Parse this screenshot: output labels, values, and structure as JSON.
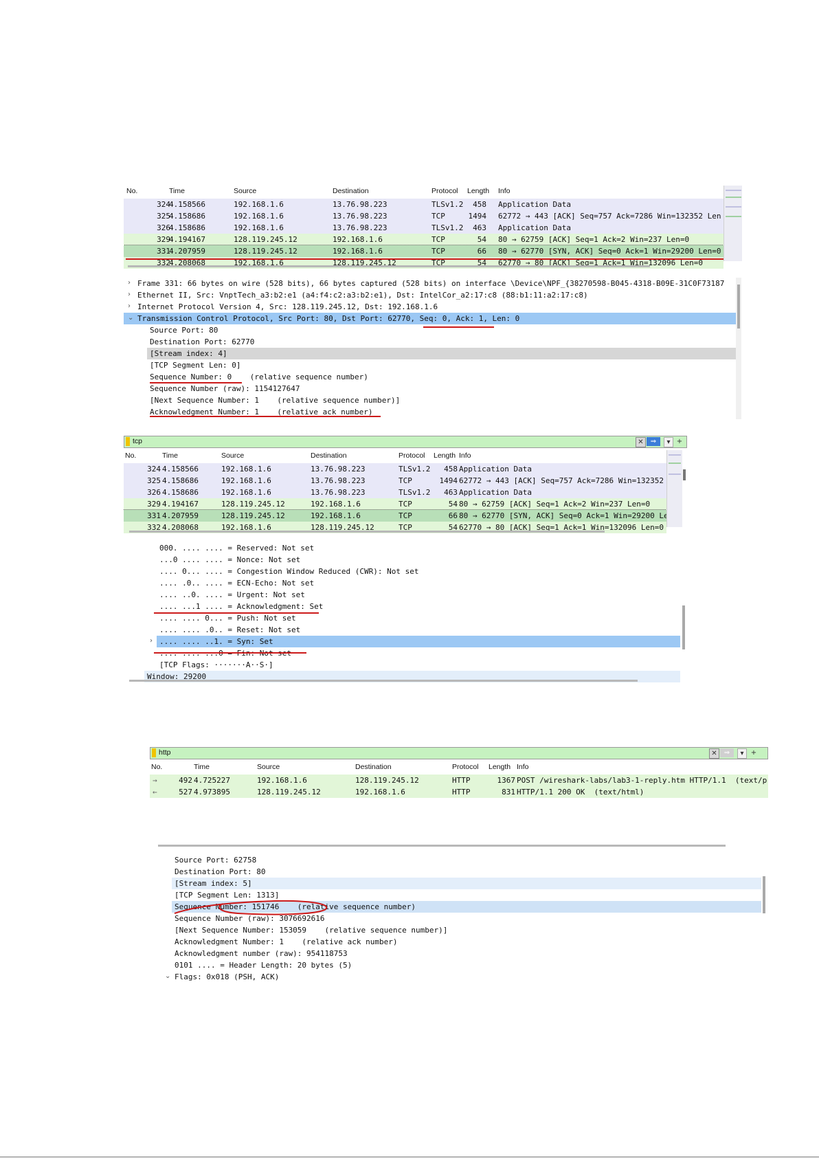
{
  "columns": [
    "No.",
    "Time",
    "Source",
    "Destination",
    "Protocol",
    "Length",
    "Info"
  ],
  "panel1": {
    "packets": [
      {
        "no": "324",
        "time": "4.158566",
        "src": "192.168.1.6",
        "dst": "13.76.98.223",
        "proto": "TLSv1.2",
        "len": "458",
        "info": "Application Data",
        "color": "purple"
      },
      {
        "no": "325",
        "time": "4.158686",
        "src": "192.168.1.6",
        "dst": "13.76.98.223",
        "proto": "TCP",
        "len": "1494",
        "info": "62772 → 443 [ACK] Seq=757 Ack=7286 Win=132352 Len",
        "color": "purple"
      },
      {
        "no": "326",
        "time": "4.158686",
        "src": "192.168.1.6",
        "dst": "13.76.98.223",
        "proto": "TLSv1.2",
        "len": "463",
        "info": "Application Data",
        "color": "purple"
      },
      {
        "no": "329",
        "time": "4.194167",
        "src": "128.119.245.12",
        "dst": "192.168.1.6",
        "proto": "TCP",
        "len": "54",
        "info": "80 → 62759 [ACK] Seq=1 Ack=2 Win=237 Len=0",
        "color": "green"
      },
      {
        "no": "331",
        "time": "4.207959",
        "src": "128.119.245.12",
        "dst": "192.168.1.6",
        "proto": "TCP",
        "len": "66",
        "info": "80 → 62770 [SYN, ACK] Seq=0 Ack=1 Win=29200 Len=0",
        "color": "sel"
      },
      {
        "no": "332",
        "time": "4.208068",
        "src": "192.168.1.6",
        "dst": "128.119.245.12",
        "proto": "TCP",
        "len": "54",
        "info": "62770 → 80 [ACK] Seq=1 Ack=1 Win=132096 Len=0",
        "color": "green"
      }
    ],
    "details": [
      {
        "text": "Frame 331: 66 bytes on wire (528 bits), 66 bytes captured (528 bits) on interface \\Device\\NPF_{38270598-B045-4318-B09E-31C0F73187",
        "arrow": "›",
        "indent": 0
      },
      {
        "text": "Ethernet II, Src: VnptTech_a3:b2:e1 (a4:f4:c2:a3:b2:e1), Dst: IntelCor_a2:17:c8 (88:b1:11:a2:17:c8)",
        "arrow": "›",
        "indent": 0
      },
      {
        "text": "Internet Protocol Version 4, Src: 128.119.245.12, Dst: 192.168.1.6",
        "arrow": "›",
        "indent": 0
      },
      {
        "text": "Transmission Control Protocol, Src Port: 80, Dst Port: 62770, Seq: 0, Ack: 1, Len: 0",
        "arrow": "⌄",
        "indent": 0,
        "hl": "blue"
      },
      {
        "text": "Source Port: 80",
        "arrow": "",
        "indent": 1
      },
      {
        "text": "Destination Port: 62770",
        "arrow": "",
        "indent": 1
      },
      {
        "text": "[Stream index: 4]",
        "arrow": "",
        "indent": 1,
        "hl": "gray"
      },
      {
        "text": "[TCP Segment Len: 0]",
        "arrow": "",
        "indent": 1
      },
      {
        "text": "Sequence Number: 0    (relative sequence number)",
        "arrow": "",
        "indent": 1
      },
      {
        "text": "Sequence Number (raw): 1154127647",
        "arrow": "",
        "indent": 1
      },
      {
        "text": "[Next Sequence Number: 1    (relative sequence number)]",
        "arrow": "",
        "indent": 1
      },
      {
        "text": "Acknowledgment Number: 1    (relative ack number)",
        "arrow": "",
        "indent": 1
      }
    ]
  },
  "panel2": {
    "filter": "tcp",
    "packets": [
      {
        "no": "324",
        "time": "4.158566",
        "src": "192.168.1.6",
        "dst": "13.76.98.223",
        "proto": "TLSv1.2",
        "len": "458",
        "info": "Application Data",
        "color": "purple"
      },
      {
        "no": "325",
        "time": "4.158686",
        "src": "192.168.1.6",
        "dst": "13.76.98.223",
        "proto": "TCP",
        "len": "1494",
        "info": "62772 → 443 [ACK] Seq=757 Ack=7286 Win=132352 Len",
        "color": "purple"
      },
      {
        "no": "326",
        "time": "4.158686",
        "src": "192.168.1.6",
        "dst": "13.76.98.223",
        "proto": "TLSv1.2",
        "len": "463",
        "info": "Application Data",
        "color": "purple"
      },
      {
        "no": "329",
        "time": "4.194167",
        "src": "128.119.245.12",
        "dst": "192.168.1.6",
        "proto": "TCP",
        "len": "54",
        "info": "80 → 62759 [ACK] Seq=1 Ack=2 Win=237 Len=0",
        "color": "green"
      },
      {
        "no": "331",
        "time": "4.207959",
        "src": "128.119.245.12",
        "dst": "192.168.1.6",
        "proto": "TCP",
        "len": "66",
        "info": "80 → 62770 [SYN, ACK] Seq=0 Ack=1 Win=29200 Len=0",
        "color": "sel"
      },
      {
        "no": "332",
        "time": "4.208068",
        "src": "192.168.1.6",
        "dst": "128.119.245.12",
        "proto": "TCP",
        "len": "54",
        "info": "62770 → 80 [ACK] Seq=1 Ack=1 Win=132096 Len=0",
        "color": "green"
      }
    ],
    "details": [
      {
        "text": "000. .... .... = Reserved: Not set",
        "arrow": "",
        "indent": 2
      },
      {
        "text": "...0 .... .... = Nonce: Not set",
        "arrow": "",
        "indent": 2
      },
      {
        "text": ".... 0... .... = Congestion Window Reduced (CWR): Not set",
        "arrow": "",
        "indent": 2
      },
      {
        "text": ".... .0.. .... = ECN-Echo: Not set",
        "arrow": "",
        "indent": 2
      },
      {
        "text": ".... ..0. .... = Urgent: Not set",
        "arrow": "",
        "indent": 2
      },
      {
        "text": ".... ...1 .... = Acknowledgment: Set",
        "arrow": "",
        "indent": 2
      },
      {
        "text": ".... .... 0... = Push: Not set",
        "arrow": "",
        "indent": 2
      },
      {
        "text": ".... .... .0.. = Reset: Not set",
        "arrow": "",
        "indent": 2
      },
      {
        "text": ".... .... ..1. = Syn: Set",
        "arrow": "›",
        "indent": 2,
        "hl": "blue"
      },
      {
        "text": ".... .... ...0 = Fin: Not set",
        "arrow": "",
        "indent": 2
      },
      {
        "text": "[TCP Flags: ·······A··S·]",
        "arrow": "",
        "indent": 2
      },
      {
        "text": "Window: 29200",
        "arrow": "",
        "indent": 1,
        "hl": "light"
      }
    ]
  },
  "panel3": {
    "filter": "http",
    "packets": [
      {
        "no": "492",
        "time": "4.725227",
        "src": "192.168.1.6",
        "dst": "128.119.245.12",
        "proto": "HTTP",
        "len": "1367",
        "info": "POST /wireshark-labs/lab3-1-reply.htm HTTP/1.1  (text/p",
        "color": "green",
        "mark": "→"
      },
      {
        "no": "527",
        "time": "4.973895",
        "src": "128.119.245.12",
        "dst": "192.168.1.6",
        "proto": "HTTP",
        "len": "831",
        "info": "HTTP/1.1 200 OK  (text/html)",
        "color": "green",
        "mark": "←"
      }
    ],
    "details": [
      {
        "text": "Source Port: 62758",
        "arrow": "",
        "indent": 1
      },
      {
        "text": "Destination Port: 80",
        "arrow": "",
        "indent": 1
      },
      {
        "text": "[Stream index: 5]",
        "arrow": "",
        "indent": 1,
        "hl": "light"
      },
      {
        "text": "[TCP Segment Len: 1313]",
        "arrow": "",
        "indent": 1
      },
      {
        "text": "Sequence Number: 151746    (relative sequence number)",
        "arrow": "",
        "indent": 1,
        "hl": "lightblue"
      },
      {
        "text": "Sequence Number (raw): 3076692616",
        "arrow": "",
        "indent": 1
      },
      {
        "text": "[Next Sequence Number: 153059    (relative sequence number)]",
        "arrow": "",
        "indent": 1
      },
      {
        "text": "Acknowledgment Number: 1    (relative ack number)",
        "arrow": "",
        "indent": 1
      },
      {
        "text": "Acknowledgment number (raw): 954118753",
        "arrow": "",
        "indent": 1
      },
      {
        "text": "0101 .... = Header Length: 20 bytes (5)",
        "arrow": "",
        "indent": 1
      },
      {
        "text": "Flags: 0x018 (PSH, ACK)",
        "arrow": "⌄",
        "indent": 1
      }
    ]
  },
  "colors": {
    "purple": "#e8e8f8",
    "green": "#e2f6d8",
    "sel": "#b8dfb8",
    "blue": "#9cc8f4",
    "gray": "#d6d6d6",
    "light": "#e3eefa",
    "lightblue": "#cfe2f6",
    "red": "#cc1a1a"
  }
}
